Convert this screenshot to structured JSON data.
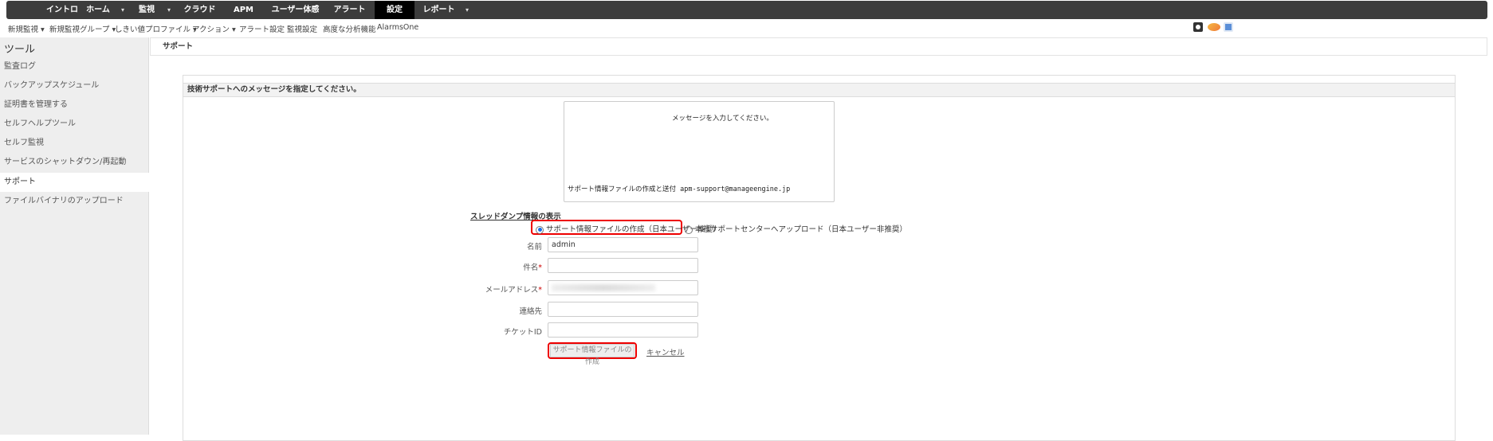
{
  "topnav": {
    "items": [
      "イントロ",
      "ホーム",
      "監視",
      "クラウド",
      "APM",
      "ユーザー体感",
      "アラート",
      "設定",
      "レポート"
    ],
    "active": "設定"
  },
  "subnav": {
    "items": [
      "新規監視 ▾",
      "新規監視グループ ▾",
      "しきい値プロファイル ▾",
      "アクション ▾",
      "アラート設定",
      "監視設定",
      "高度な分析機能",
      "AlarmsOne"
    ]
  },
  "sidebar": {
    "title": "ツール",
    "items": [
      "監査ログ",
      "バックアップスケジュール",
      "証明書を管理する",
      "セルフヘルプツール",
      "セルフ監視",
      "サービスのシャットダウン/再起動",
      "サポート",
      "ファイルバイナリのアップロード"
    ],
    "active": "サポート"
  },
  "main": {
    "title": "サポート",
    "panel_title": "技術サポートへのメッセージを指定してください。",
    "message_line1": "メッセージを入力してください。",
    "message_line2": "サポート情報ファイルの作成と送付 apm-support@manageengine.jp",
    "thread_dump_label": "スレッドダンプ情報の表示",
    "radio1": "サポート情報ファイルの作成（日本ユーザー推奨）",
    "radio2": "本社サポートセンターへアップロード（日本ユーザー非推奨）",
    "fields": {
      "name_label": "名前",
      "name_value": "admin",
      "subject_label": "件名",
      "email_label": "メールアドレス",
      "contact_label": "連絡先",
      "ticket_label": "チケットID"
    },
    "required_mark": "*",
    "submit_label": "サポート情報ファイルの作成",
    "cancel_label": "キャンセル"
  }
}
